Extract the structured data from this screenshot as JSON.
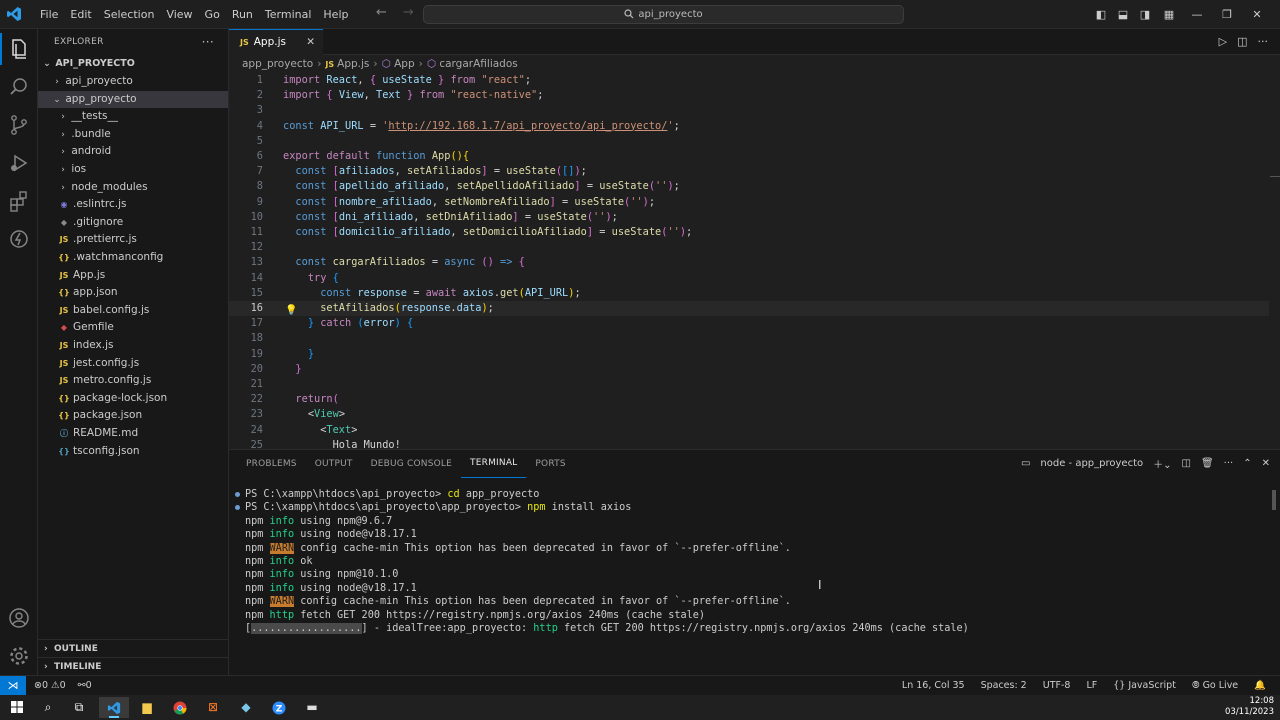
{
  "titlebar": {
    "menu": [
      "File",
      "Edit",
      "Selection",
      "View",
      "Go",
      "Run",
      "Terminal",
      "Help"
    ],
    "search": "api_proyecto"
  },
  "explorer": {
    "title": "EXPLORER",
    "root": "API_PROYECTO",
    "items": [
      {
        "label": "api_proyecto",
        "type": "folder",
        "open": false,
        "depth": 1
      },
      {
        "label": "app_proyecto",
        "type": "folder",
        "open": true,
        "depth": 1,
        "selected": true
      },
      {
        "label": "__tests__",
        "type": "folder",
        "open": false,
        "depth": 2
      },
      {
        "label": ".bundle",
        "type": "folder",
        "open": false,
        "depth": 2
      },
      {
        "label": "android",
        "type": "folder",
        "open": false,
        "depth": 2
      },
      {
        "label": "ios",
        "type": "folder",
        "open": false,
        "depth": 2
      },
      {
        "label": "node_modules",
        "type": "folder",
        "open": false,
        "depth": 2
      },
      {
        "label": ".eslintrc.js",
        "type": "eslint",
        "depth": 2
      },
      {
        "label": ".gitignore",
        "type": "git",
        "depth": 2
      },
      {
        "label": ".prettierrc.js",
        "type": "js",
        "depth": 2
      },
      {
        "label": ".watchmanconfig",
        "type": "json",
        "depth": 2
      },
      {
        "label": "App.js",
        "type": "js",
        "depth": 2
      },
      {
        "label": "app.json",
        "type": "json",
        "depth": 2
      },
      {
        "label": "babel.config.js",
        "type": "js",
        "depth": 2
      },
      {
        "label": "Gemfile",
        "type": "gem",
        "depth": 2
      },
      {
        "label": "index.js",
        "type": "js",
        "depth": 2
      },
      {
        "label": "jest.config.js",
        "type": "js",
        "depth": 2
      },
      {
        "label": "metro.config.js",
        "type": "js",
        "depth": 2
      },
      {
        "label": "package-lock.json",
        "type": "json",
        "depth": 2
      },
      {
        "label": "package.json",
        "type": "json",
        "depth": 2
      },
      {
        "label": "README.md",
        "type": "md",
        "depth": 2
      },
      {
        "label": "tsconfig.json",
        "type": "ts",
        "depth": 2
      }
    ],
    "outline": "OUTLINE",
    "timeline": "TIMELINE"
  },
  "editor": {
    "tab": "App.js",
    "breadcrumb": [
      "app_proyecto",
      "App.js",
      "App",
      "cargarAfiliados"
    ],
    "lines": [
      {
        "n": "1",
        "html": "<span class='k'>import</span> <span class='v'>React</span><span class='p'>, </span><span class='br2'>{</span> <span class='v'>useState</span> <span class='br2'>}</span> <span class='k'>from</span> <span class='s'>\"react\"</span><span class='p'>;</span>"
      },
      {
        "n": "2",
        "html": "<span class='k'>import</span> <span class='br2'>{</span> <span class='v'>View</span><span class='p'>, </span><span class='v'>Text</span> <span class='br2'>}</span> <span class='k'>from</span> <span class='s'>\"react-native\"</span><span class='p'>;</span>"
      },
      {
        "n": "3",
        "html": ""
      },
      {
        "n": "4",
        "html": "<span class='b'>const</span> <span class='v'>API_URL</span> <span class='p'>=</span> <span class='s'>'</span><span class='su'>http://192.168.1.7/api_proyecto/api_proyecto/</span><span class='s'>'</span><span class='p'>;</span>"
      },
      {
        "n": "5",
        "html": ""
      },
      {
        "n": "6",
        "html": "<span class='k'>export</span> <span class='k'>default</span> <span class='b'>function</span> <span class='fn'>App</span><span class='br1'>()</span><span class='br1'>{</span>"
      },
      {
        "n": "7",
        "html": "  <span class='b'>const</span> <span class='br2'>[</span><span class='v'>afiliados</span><span class='p'>, </span><span class='fn'>setAfiliados</span><span class='br2'>]</span> <span class='p'>=</span> <span class='fn'>useState</span><span class='br2'>(</span><span class='br3'>[]</span><span class='br2'>)</span><span class='p'>;</span>"
      },
      {
        "n": "8",
        "html": "  <span class='b'>const</span> <span class='br2'>[</span><span class='v'>apellido_afiliado</span><span class='p'>, </span><span class='fn'>setApellidoAfiliado</span><span class='br2'>]</span> <span class='p'>=</span> <span class='fn'>useState</span><span class='br2'>(</span><span class='s'>''</span><span class='br2'>)</span><span class='p'>;</span>"
      },
      {
        "n": "9",
        "html": "  <span class='b'>const</span> <span class='br2'>[</span><span class='v'>nombre_afiliado</span><span class='p'>, </span><span class='fn'>setNombreAfiliado</span><span class='br2'>]</span> <span class='p'>=</span> <span class='fn'>useState</span><span class='br2'>(</span><span class='s'>''</span><span class='br2'>)</span><span class='p'>;</span>"
      },
      {
        "n": "10",
        "html": "  <span class='b'>const</span> <span class='br2'>[</span><span class='v'>dni_afiliado</span><span class='p'>, </span><span class='fn'>setDniAfiliado</span><span class='br2'>]</span> <span class='p'>=</span> <span class='fn'>useState</span><span class='br2'>(</span><span class='s'>''</span><span class='br2'>)</span><span class='p'>;</span>"
      },
      {
        "n": "11",
        "html": "  <span class='b'>const</span> <span class='br2'>[</span><span class='v'>domicilio_afiliado</span><span class='p'>, </span><span class='fn'>setDomicilioAfiliado</span><span class='br2'>]</span> <span class='p'>=</span> <span class='fn'>useState</span><span class='br2'>(</span><span class='s'>''</span><span class='br2'>)</span><span class='p'>;</span>"
      },
      {
        "n": "12",
        "html": ""
      },
      {
        "n": "13",
        "html": "  <span class='b'>const</span> <span class='fn'>cargarAfiliados</span> <span class='p'>=</span> <span class='b'>async</span> <span class='br2'>()</span> <span class='b'>=&gt;</span> <span class='br2'>{</span>"
      },
      {
        "n": "14",
        "html": "    <span class='k'>try</span> <span class='br3'>{</span>"
      },
      {
        "n": "15",
        "html": "      <span class='b'>const</span> <span class='v'>response</span> <span class='p'>=</span> <span class='k'>await</span> <span class='v'>axios</span><span class='p'>.</span><span class='fn'>get</span><span class='br1'>(</span><span class='v'>API_URL</span><span class='br1'>)</span><span class='p'>;</span>"
      },
      {
        "n": "16",
        "html": "      <span class='fn'>setAfiliados</span><span class='br1'>(</span><span class='v'>response</span><span class='p'>.</span><span class='v'>data</span><span class='br1'>)</span><span class='p'>;</span>",
        "current": true
      },
      {
        "n": "17",
        "html": "    <span class='br3'>}</span> <span class='k'>catch</span> <span class='br3'>(</span><span class='v'>error</span><span class='br3'>)</span> <span class='br3'>{</span>"
      },
      {
        "n": "18",
        "html": ""
      },
      {
        "n": "19",
        "html": "    <span class='br3'>}</span>"
      },
      {
        "n": "20",
        "html": "  <span class='br2'>}</span>"
      },
      {
        "n": "21",
        "html": ""
      },
      {
        "n": "22",
        "html": "  <span class='k'>return</span><span class='br2'>(</span>"
      },
      {
        "n": "23",
        "html": "    <span class='p'>&lt;</span><span class='t'>View</span><span class='p'>&gt;</span>"
      },
      {
        "n": "24",
        "html": "      <span class='p'>&lt;</span><span class='t'>Text</span><span class='p'>&gt;</span>"
      },
      {
        "n": "25",
        "html": "        <span class='p'>Hola Mundo!</span>"
      }
    ]
  },
  "panel": {
    "tabs": [
      "PROBLEMS",
      "OUTPUT",
      "DEBUG CONSOLE",
      "TERMINAL",
      "PORTS"
    ],
    "active_tab": "TERMINAL",
    "terminal_name": "node - app_proyecto",
    "lines": [
      {
        "dot": true,
        "html": "PS C:\\xampp\\htdocs\\api_proyecto&gt; <span class='cmd'>cd</span> app_proyecto"
      },
      {
        "dot": true,
        "html": "PS C:\\xampp\\htdocs\\api_proyecto\\app_proyecto&gt; <span class='cmd'>npm</span> install axios"
      },
      {
        "html": "npm <span class='g'>info</span> using npm@9.6.7"
      },
      {
        "html": "npm <span class='g'>info</span> using node@v18.17.1"
      },
      {
        "html": "npm <span class='w'>WARN</span> config cache-min This option has been deprecated in favor of `--prefer-offline`."
      },
      {
        "html": "npm <span class='g'>info</span> ok"
      },
      {
        "html": "npm <span class='g'>info</span> using npm@10.1.0"
      },
      {
        "html": "npm <span class='g'>info</span> using node@v18.17.1"
      },
      {
        "html": "npm <span class='w'>WARN</span> config cache-min This option has been deprecated in favor of `--prefer-offline`."
      },
      {
        "html": "npm <span class='g'>http</span> fetch GET 200 https://registry.npmjs.org/axios 240ms (cache stale)"
      },
      {
        "html": "[<span class='progress'>..................</span>] - idealTree:app_proyecto: <span class='g'>http</span> fetch GET 200 https://registry.npmjs.org/axios 240ms (cache stale)"
      }
    ]
  },
  "statusbar": {
    "errors": "0",
    "warnings": "0",
    "ports": "0",
    "position": "Ln 16, Col 35",
    "spaces": "Spaces: 2",
    "encoding": "UTF-8",
    "eol": "LF",
    "language": "JavaScript",
    "golive": "Go Live"
  },
  "taskbar": {
    "time": "12:08",
    "date": "03/11/2023"
  },
  "colors": {
    "accent": "#0078d4",
    "editor_bg": "#1f1f1f",
    "sidebar_bg": "#181818"
  }
}
